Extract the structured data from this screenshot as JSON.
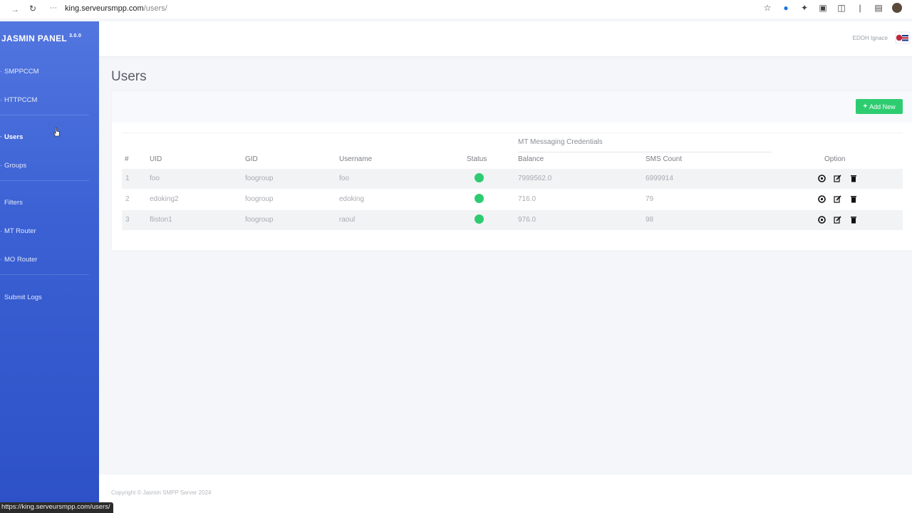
{
  "browser": {
    "url_host": "king.serveursmpp.com",
    "url_path": "/users/",
    "status_url": "https://king.serveursmpp.com/users/"
  },
  "sidebar": {
    "brand": "JASMIN PANEL",
    "version": "3.0.0",
    "items": [
      {
        "label": "SMPPCCM"
      },
      {
        "label": "HTTPCCM"
      },
      {
        "label": "Users"
      },
      {
        "label": "Groups"
      },
      {
        "label": "Filters"
      },
      {
        "label": "MT Router"
      },
      {
        "label": "MO Router"
      },
      {
        "label": "Submit Logs"
      }
    ]
  },
  "header": {
    "user_name": "EDOH Ignace"
  },
  "main": {
    "title": "Users",
    "add_button": "Add New",
    "table": {
      "group_label": "MT Messaging Credentials",
      "columns": {
        "num": "#",
        "uid": "UID",
        "gid": "GID",
        "username": "Username",
        "status": "Status",
        "balance": "Balance",
        "sms_count": "SMS Count",
        "option": "Option"
      },
      "rows": [
        {
          "num": "1",
          "uid": "foo",
          "gid": "foogroup",
          "username": "foo",
          "status": "active",
          "balance": "7999562.0",
          "sms_count": "6999914"
        },
        {
          "num": "2",
          "uid": "edoking2",
          "gid": "foogroup",
          "username": "edoking",
          "status": "active",
          "balance": "716.0",
          "sms_count": "79"
        },
        {
          "num": "3",
          "uid": "fliston1",
          "gid": "foogroup",
          "username": "raoul",
          "status": "active",
          "balance": "976.0",
          "sms_count": "98"
        }
      ]
    }
  },
  "footer": {
    "text": "Copyright © Jasmin SMPP Server 2024"
  },
  "colors": {
    "sidebar_top": "#5276df",
    "sidebar_bottom": "#2d50c6",
    "accent_green": "#2ecc71",
    "page_bg": "#f4f6f9"
  }
}
